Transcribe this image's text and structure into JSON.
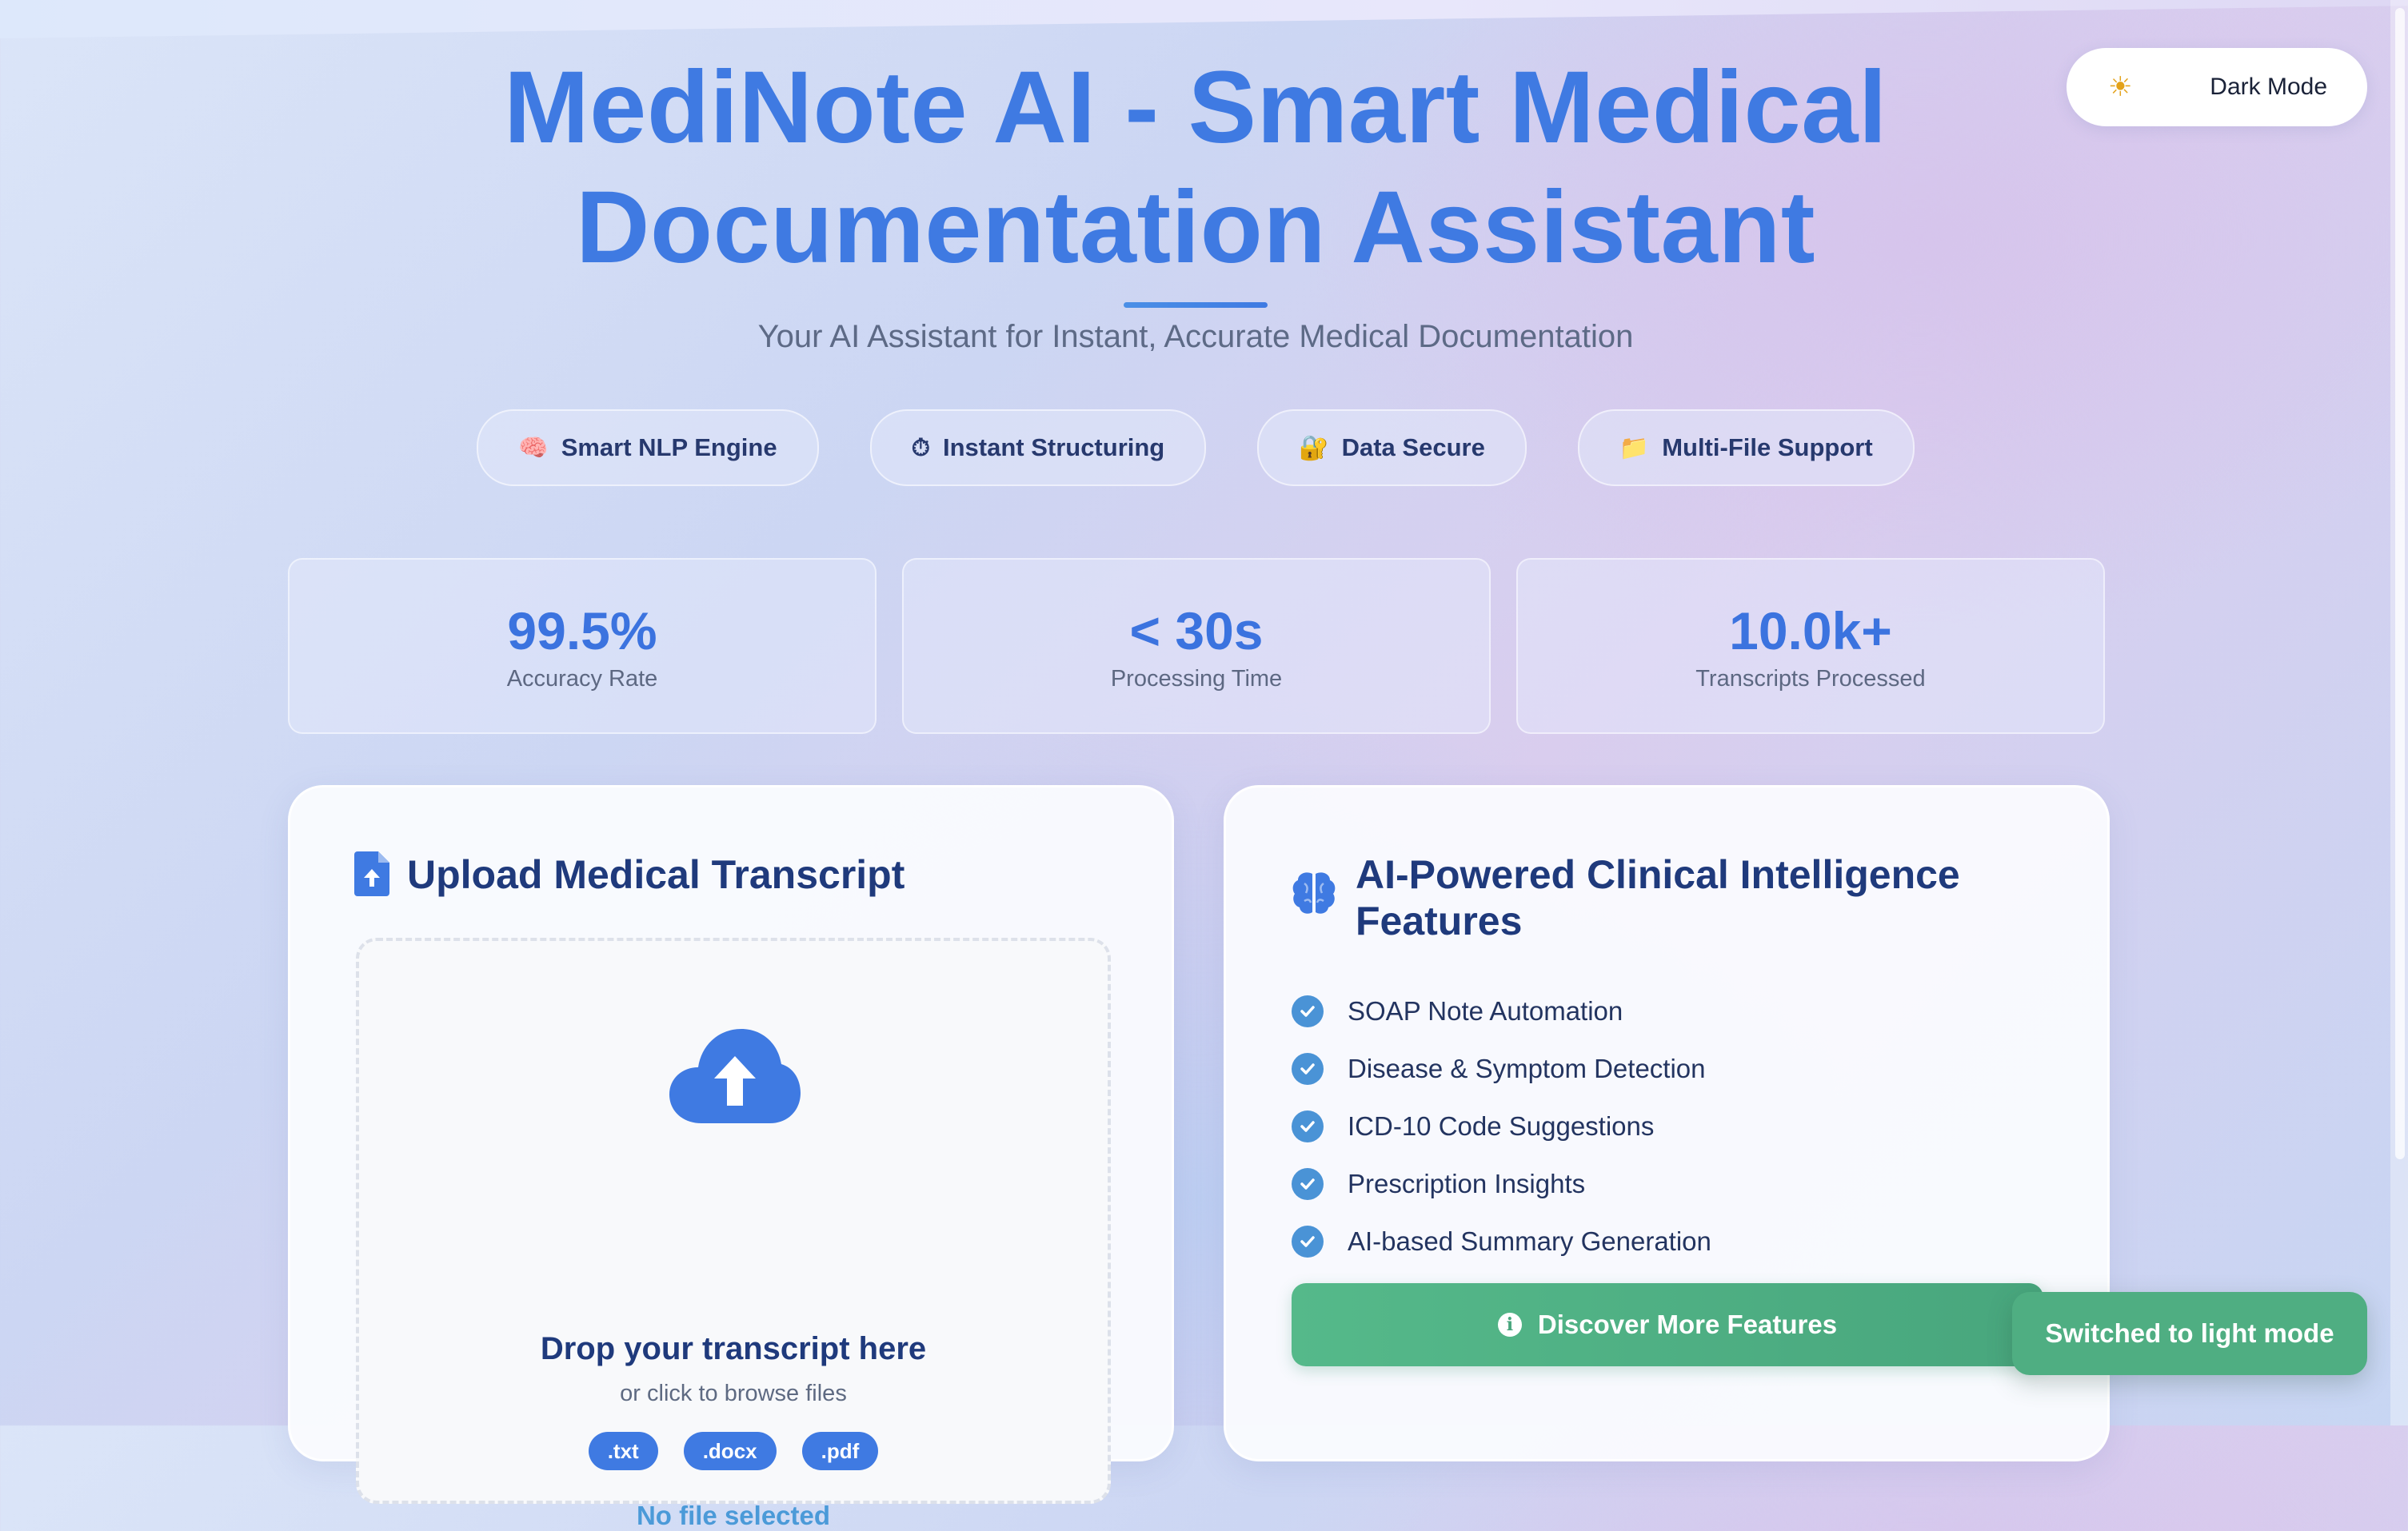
{
  "header": {
    "title_line1": "MediNote AI - Smart Medical",
    "title_line2": "Documentation Assistant",
    "subtitle": "Your AI Assistant for Instant, Accurate Medical Documentation"
  },
  "theme_toggle": {
    "icon": "sun-icon",
    "label": "Dark Mode"
  },
  "feature_pills": [
    {
      "icon": "brain-emoji-icon",
      "label": "Smart NLP Engine"
    },
    {
      "icon": "stopwatch-emoji-icon",
      "label": "Instant Structuring"
    },
    {
      "icon": "lock-key-emoji-icon",
      "label": "Data Secure"
    },
    {
      "icon": "folder-emoji-icon",
      "label": "Multi-File Support"
    }
  ],
  "stats": [
    {
      "value": "99.5%",
      "label": "Accuracy Rate"
    },
    {
      "value": "< 30s",
      "label": "Processing Time"
    },
    {
      "value": "10.0k+",
      "label": "Transcripts Processed"
    }
  ],
  "upload_card": {
    "title": "Upload Medical Transcript",
    "drop_title": "Drop your transcript here",
    "drop_subtitle": "or click to browse files",
    "file_types": [
      ".txt",
      ".docx",
      ".pdf"
    ],
    "status": "No file selected"
  },
  "features_card": {
    "title": "AI-Powered Clinical Intelligence Features",
    "items": [
      "SOAP Note Automation",
      "Disease & Symptom Detection",
      "ICD-10 Code Suggestions",
      "Prescription Insights",
      "AI-based Summary Generation"
    ],
    "button_label": "Discover More Features"
  },
  "toast": {
    "message": "Switched to light mode"
  },
  "colors": {
    "primary": "#3f7ae2",
    "heading": "#1f3a7c",
    "success": "#4fae82",
    "check": "#4a93d6"
  }
}
